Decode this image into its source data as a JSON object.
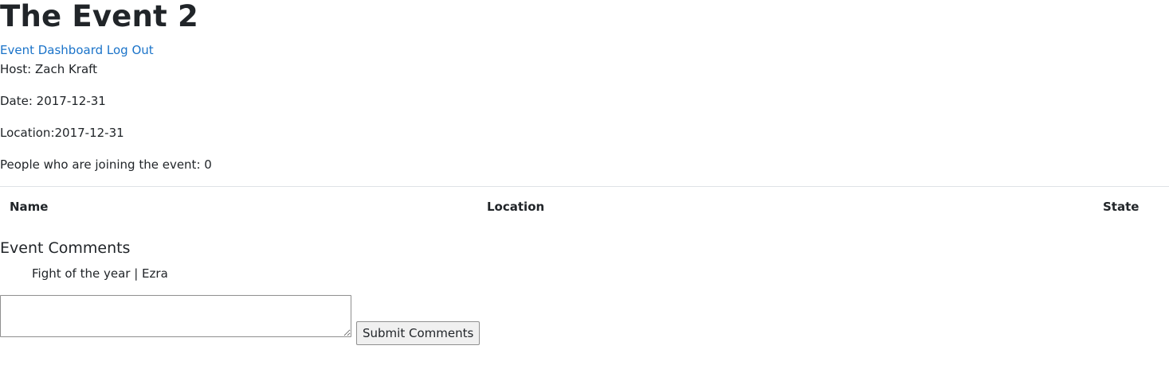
{
  "event": {
    "title": "The Event 2",
    "host": "Host: Zach Kraft",
    "date": "Date: 2017-12-31",
    "location": "Location:2017-12-31",
    "joining": "People who are joining the event: 0"
  },
  "nav": {
    "dashboard_label": "Event Dashboard",
    "logout_label": "Log Out"
  },
  "table": {
    "headers": [
      "Name",
      "Location",
      "State"
    ],
    "rows": []
  },
  "comments": {
    "title": "Event Comments",
    "items": [
      {
        "text": "Fight of the year | Ezra"
      }
    ],
    "input_value": "",
    "submit_label": "Submit Comments"
  }
}
